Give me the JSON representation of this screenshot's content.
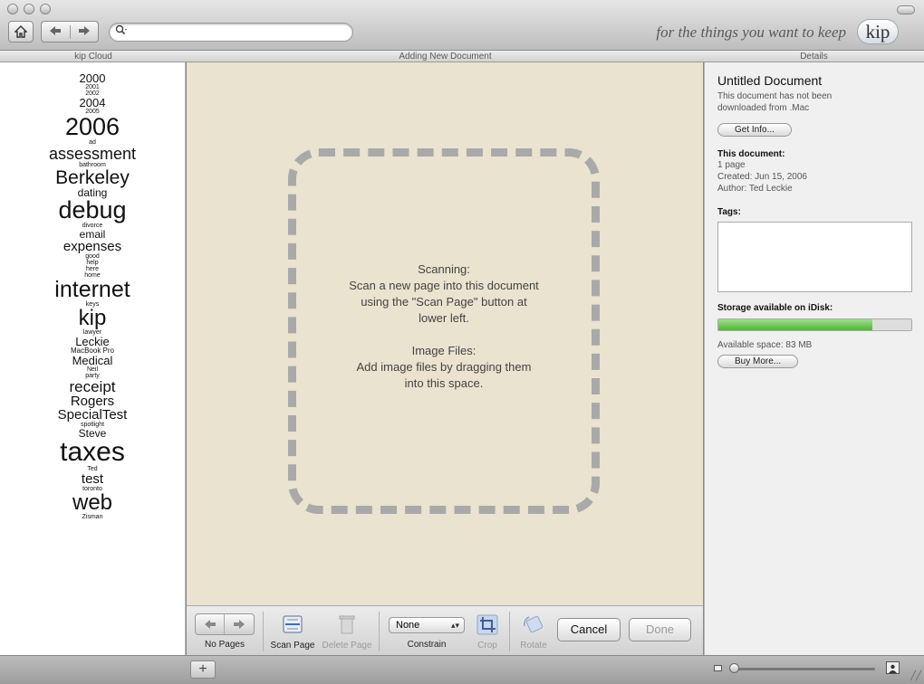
{
  "toolbar": {
    "search_placeholder": "",
    "tagline": "for the things you want to keep",
    "logo": "kip"
  },
  "headers": {
    "left": "kip Cloud",
    "middle": "Adding New Document",
    "right": "Details"
  },
  "cloud": [
    {
      "text": "2000",
      "size": 13
    },
    {
      "text": "2001",
      "size": 7
    },
    {
      "text": "2002",
      "size": 7
    },
    {
      "text": "2004",
      "size": 13
    },
    {
      "text": "2005",
      "size": 7
    },
    {
      "text": "2006",
      "size": 27
    },
    {
      "text": "ad",
      "size": 7
    },
    {
      "text": "assessment",
      "size": 18
    },
    {
      "text": "bathroom",
      "size": 7
    },
    {
      "text": "Berkeley",
      "size": 21
    },
    {
      "text": "dating",
      "size": 12
    },
    {
      "text": "debug",
      "size": 27
    },
    {
      "text": "divorce",
      "size": 7
    },
    {
      "text": "email",
      "size": 12
    },
    {
      "text": "expenses",
      "size": 15
    },
    {
      "text": "good",
      "size": 7
    },
    {
      "text": "help",
      "size": 7
    },
    {
      "text": "here",
      "size": 7
    },
    {
      "text": "home",
      "size": 7
    },
    {
      "text": "internet",
      "size": 25
    },
    {
      "text": "keys",
      "size": 7
    },
    {
      "text": "kip",
      "size": 24
    },
    {
      "text": "lawyer",
      "size": 7
    },
    {
      "text": "Leckie",
      "size": 13
    },
    {
      "text": "MacBook Pro",
      "size": 8
    },
    {
      "text": "Medical",
      "size": 13
    },
    {
      "text": "Neil",
      "size": 7
    },
    {
      "text": "party",
      "size": 7
    },
    {
      "text": "receipt",
      "size": 17
    },
    {
      "text": "Rogers",
      "size": 15
    },
    {
      "text": "SpecialTest",
      "size": 15
    },
    {
      "text": "spotlight",
      "size": 7
    },
    {
      "text": "Steve",
      "size": 12
    },
    {
      "text": "taxes",
      "size": 30
    },
    {
      "text": "Ted",
      "size": 7
    },
    {
      "text": "test",
      "size": 15
    },
    {
      "text": "toronto",
      "size": 7
    },
    {
      "text": "web",
      "size": 24
    },
    {
      "text": "Zisman",
      "size": 7
    }
  ],
  "dropzone": {
    "line1": "Scanning:",
    "line2": "Scan a new page into this document",
    "line3": "using the \"Scan Page\" button at",
    "line4": "lower left.",
    "line5": "Image Files:",
    "line6": "Add image files by dragging them",
    "line7": "into this space."
  },
  "doc_toolbar": {
    "pages_label": "No Pages",
    "scan_label": "Scan Page",
    "delete_label": "Delete Page",
    "constrain_value": "None",
    "constrain_label": "Constrain",
    "crop_label": "Crop",
    "rotate_label": "Rotate",
    "cancel_label": "Cancel",
    "done_label": "Done"
  },
  "details": {
    "title": "Untitled Document",
    "note_line1": "This document has not been",
    "note_line2": "downloaded from .Mac",
    "get_info": "Get Info...",
    "this_document": "This document:",
    "pages": "1 page",
    "created": "Created: Jun 15, 2006",
    "author": "Author: Ted Leckie",
    "tags_label": "Tags:",
    "storage_label": "Storage available on iDisk:",
    "storage_fraction": 0.8,
    "available": "Available space: 83 MB",
    "buy_more": "Buy More..."
  },
  "statusbar": {
    "add": "+",
    "zoom_fraction": 0.0
  }
}
